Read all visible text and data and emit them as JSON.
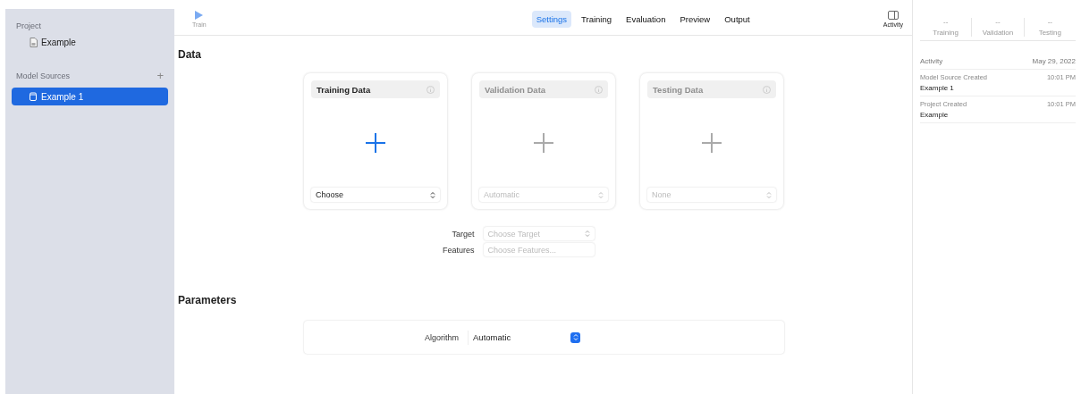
{
  "sidebar": {
    "project_label": "Project",
    "project": {
      "name": "Example"
    },
    "sources_label": "Model Sources",
    "sources_add": "+",
    "sources": [
      {
        "name": "Example 1",
        "selected": true
      }
    ]
  },
  "toolbar": {
    "train": {
      "label": "Train",
      "disabled": true
    },
    "tabs": [
      {
        "label": "Settings",
        "selected": true
      },
      {
        "label": "Training",
        "selected": false
      },
      {
        "label": "Evaluation",
        "selected": false
      },
      {
        "label": "Preview",
        "selected": false
      },
      {
        "label": "Output",
        "selected": false
      }
    ],
    "activity": {
      "label": "Activity"
    }
  },
  "data_section": {
    "title": "Data",
    "cards": [
      {
        "title": "Training Data",
        "disabled": false,
        "select": "Choose"
      },
      {
        "title": "Validation Data",
        "disabled": true,
        "select": "Automatic"
      },
      {
        "title": "Testing Data",
        "disabled": true,
        "select": "None"
      }
    ],
    "fields": [
      {
        "kind": "select",
        "label": "Target",
        "placeholder": "Choose Target"
      },
      {
        "kind": "field",
        "label": "Features",
        "placeholder": "Choose Features..."
      }
    ]
  },
  "parameters": {
    "title": "Parameters",
    "algorithm": {
      "label": "Algorithm",
      "value": "Automatic"
    }
  },
  "inspector": {
    "metrics": [
      {
        "value": "--",
        "label": "Training"
      },
      {
        "value": "--",
        "label": "Validation"
      },
      {
        "value": "--",
        "label": "Testing"
      }
    ],
    "activity_title": "Activity",
    "activity_date": "May 29, 2022",
    "events": [
      {
        "title": "Model Source Created",
        "time": "10:01 PM",
        "subject": "Example 1"
      },
      {
        "title": "Project Created",
        "time": "10:01 PM",
        "subject": "Example"
      }
    ]
  }
}
